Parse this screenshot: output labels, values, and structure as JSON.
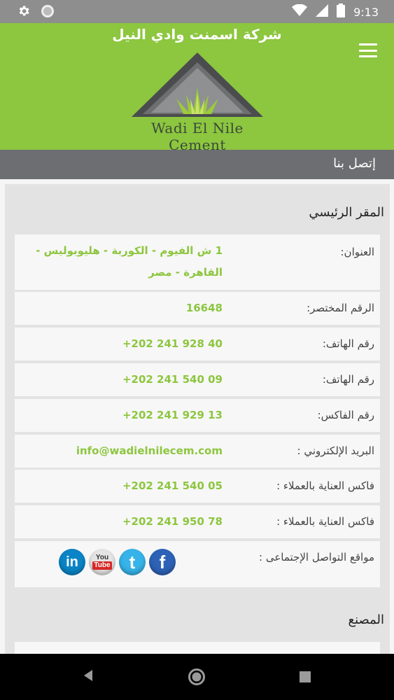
{
  "status_bar": {
    "time": "9:13",
    "icons": [
      "gear-icon",
      "circle-icon",
      "wifi-icon",
      "signal-icon",
      "battery-icon"
    ]
  },
  "header": {
    "title": "شركة اسمنت وادي النيل",
    "logo_text": "Wadi El Nile Cement",
    "background": "#8dc63f"
  },
  "page": {
    "title": "إتصل بنا"
  },
  "sections": {
    "main_office": "المقر الرئيسي",
    "factory": "المصنع"
  },
  "rows": [
    {
      "label": "العنوان:",
      "value": "1 ش الفيوم - الكوربة - هليوبوليس - القاهرة - مصر"
    },
    {
      "label": "الرقم المختصر:",
      "value": "16648"
    },
    {
      "label": "رقم الهاتف:",
      "value": "+202 241 928 40"
    },
    {
      "label": "رقم الهاتف:",
      "value": "+202 241 540 09"
    },
    {
      "label": "رقم الفاكس:",
      "value": "+202 241 929 13"
    },
    {
      "label": "البريد الإلكتروني :",
      "value": "info@wadielnilecem.com"
    },
    {
      "label": "فاكس العناية بالعملاء :",
      "value": "+202 241 540 05"
    },
    {
      "label": "فاكس العناية بالعملاء :",
      "value": "+202 241 950 78"
    },
    {
      "label": "مواقع التواصل الإجتماعى :",
      "value": ""
    }
  ],
  "social": {
    "linkedin": "in",
    "youtube_line1": "You",
    "youtube_line2": "Tube",
    "twitter": "t",
    "facebook": "f"
  },
  "colors": {
    "accent": "#8dc63f",
    "page_bar": "#6d6e71",
    "status_bar": "#8e8e8e"
  }
}
